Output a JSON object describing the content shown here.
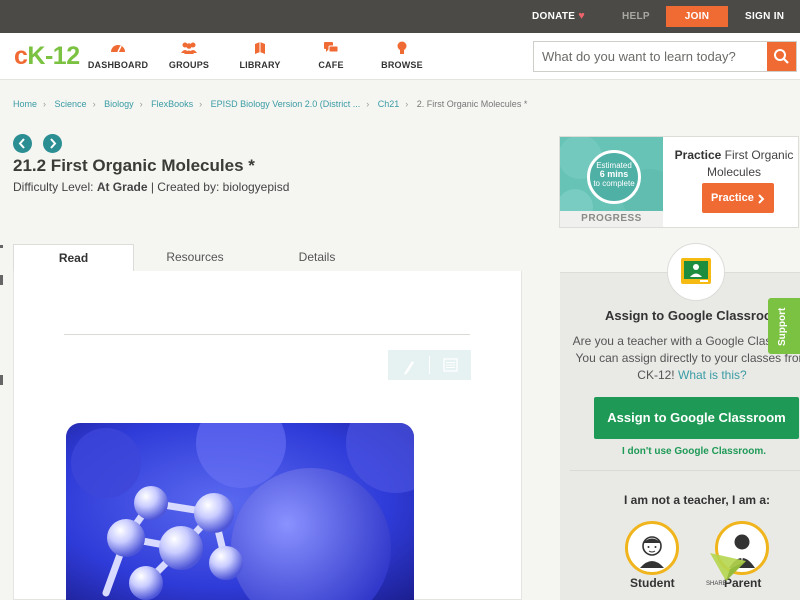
{
  "topbar": {
    "donate": "DONATE",
    "help": "HELP",
    "join": "JOIN",
    "signin": "SIGN IN"
  },
  "nav": {
    "logo": [
      "c",
      "K",
      "-",
      "12"
    ],
    "items": [
      {
        "label": "DASHBOARD",
        "icon": "dashboard-icon"
      },
      {
        "label": "GROUPS",
        "icon": "groups-icon"
      },
      {
        "label": "LIBRARY",
        "icon": "library-icon"
      },
      {
        "label": "CAFE",
        "icon": "cafe-icon"
      },
      {
        "label": "BROWSE",
        "icon": "browse-icon"
      }
    ],
    "search_placeholder": "What do you want to learn today?"
  },
  "breadcrumb": [
    "Home",
    "Science",
    "Biology",
    "FlexBooks",
    "EPISD Biology Version 2.0 (District ...",
    "Ch21",
    "2. First Organic Molecules *"
  ],
  "lesson": {
    "title": "21.2 First Organic Molecules *",
    "difficulty_prefix": "Difficulty Level: ",
    "difficulty": "At Grade",
    "created_by": " | Created by: biologyepisd"
  },
  "tabs": [
    "Read",
    "Resources",
    "Details"
  ],
  "practice": {
    "estimate_line1": "Estimated",
    "estimate_line2": "6 mins",
    "estimate_line3": "to complete",
    "progress_label": "PROGRESS",
    "title_bold": "Practice",
    "title_rest": " First Organic Molecules",
    "button": "Practice"
  },
  "google_classroom": {
    "title": "Assign to Google Classroom",
    "desc": "Are you a teacher with a Google Classroom? You can assign directly to your classes from CK-12!",
    "what_link": "What is this?",
    "button": "Assign to Google Classroom",
    "dont_use": "I don't use Google Classroom.",
    "not_teacher": "I am not a teacher, I am a:",
    "roles": [
      "Student",
      "Parent"
    ]
  },
  "support": "Support",
  "share_label": "SHARE",
  "colors": {
    "brand_orange": "#f06a34",
    "brand_green": "#7cc242",
    "teal": "#2a8e93",
    "classroom_green": "#1e9a56"
  }
}
